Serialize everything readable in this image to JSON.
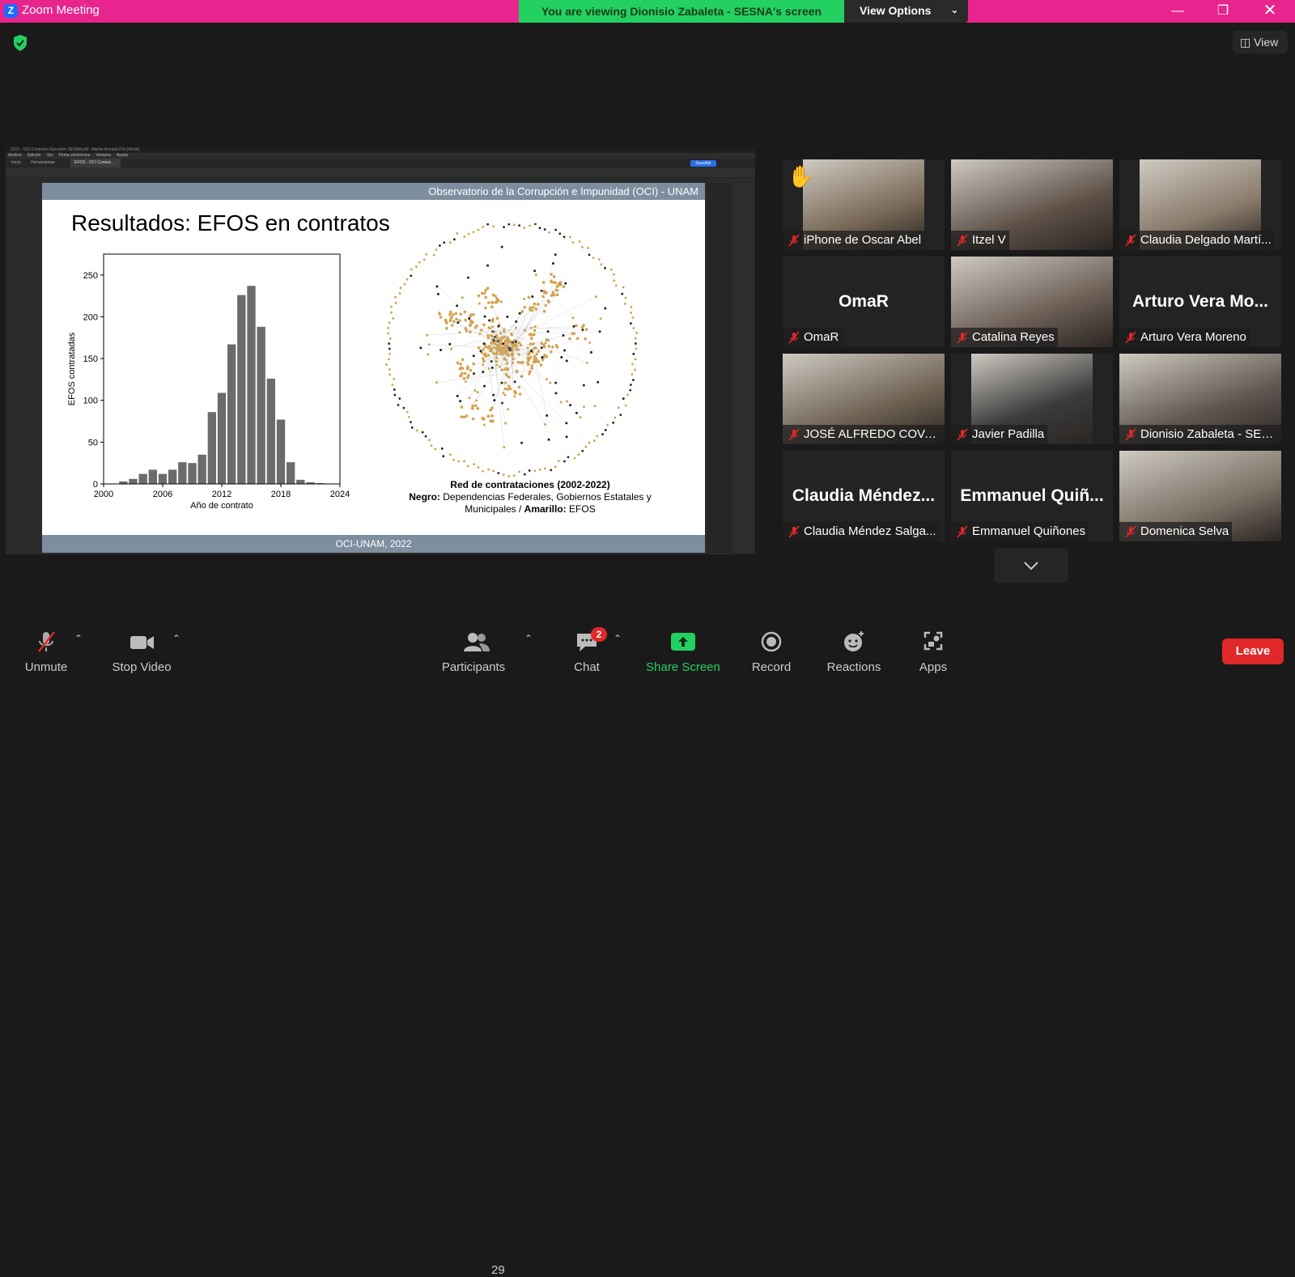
{
  "window": {
    "title": "Zoom Meeting",
    "viewing_banner": "You are viewing Dionisio Zabaleta - SESNA's screen",
    "view_options": "View Options",
    "view_button": "View"
  },
  "shared_screen": {
    "acrobat_title": "2022 - OCI Contratos Ejecutivo SESNA.pdf - Adobe Acrobat Pro (64-bit)",
    "menu": [
      "Archivo",
      "Edición",
      "Ver",
      "Firma electrónica",
      "Ventana",
      "Ayuda"
    ],
    "tabs": [
      "Inicio",
      "Herramientas",
      "EFOS - OCI Contrat..."
    ],
    "subscribe": "Suscribir",
    "slide_header": "Observatorio de la Corrupción e Impunidad (OCI) - UNAM",
    "slide_title": "Resultados: EFOS en contratos",
    "slide_footer": "OCI-UNAM, 2022",
    "network_caption": {
      "title": "Red de contrataciones (2002-2022)",
      "negro_label": "Negro:",
      "negro_text": "Dependencias Federales, Gobiernos Estatales y Municipales /",
      "amarillo_label": "Amarillo:",
      "amarillo_text": "EFOS"
    }
  },
  "chart_data": {
    "type": "bar",
    "title": "",
    "xlabel": "Año de contrato",
    "ylabel": "EFOS contratadas",
    "x": [
      2002,
      2003,
      2004,
      2005,
      2006,
      2007,
      2008,
      2009,
      2010,
      2011,
      2012,
      2013,
      2014,
      2015,
      2016,
      2017,
      2018,
      2019,
      2020,
      2021,
      2022
    ],
    "values": [
      3,
      6,
      12,
      17,
      12,
      17,
      26,
      25,
      35,
      86,
      109,
      167,
      226,
      237,
      188,
      126,
      77,
      26,
      5,
      2,
      1
    ],
    "xlim": [
      2000,
      2024
    ],
    "ylim": [
      0,
      275
    ],
    "xticks": [
      "2000",
      "2006",
      "2012",
      "2018",
      "2024"
    ],
    "yticks": [
      "0",
      "50",
      "100",
      "150",
      "200",
      "250"
    ],
    "bar_color": "#6b6b6b"
  },
  "participants": [
    {
      "name": "iPhone de Oscar Abel",
      "big": "",
      "video": true,
      "hand": "✋",
      "active": false
    },
    {
      "name": "Itzel V",
      "big": "",
      "video": true,
      "active": false
    },
    {
      "name": "Claudia Delgado Martí...",
      "big": "",
      "video": true,
      "active": false
    },
    {
      "name": "OmaR",
      "big": "OmaR",
      "video": false,
      "active": false
    },
    {
      "name": "Catalina Reyes",
      "big": "",
      "video": true,
      "active": false
    },
    {
      "name": "Arturo Vera Moreno",
      "big": "Arturo Vera Mo...",
      "video": false,
      "active": false
    },
    {
      "name": "JOSÉ ALFREDO COVAR...",
      "big": "",
      "video": true,
      "active": false
    },
    {
      "name": "Javier Padilla",
      "big": "",
      "video": true,
      "active": false
    },
    {
      "name": "Dionisio Zabaleta - SESNA",
      "big": "",
      "video": true,
      "active": true
    },
    {
      "name": "Claudia Méndez Salga...",
      "big": "Claudia Méndez...",
      "video": false,
      "active": false
    },
    {
      "name": "Emmanuel Quiñones",
      "big": "Emmanuel Quiñ...",
      "video": false,
      "active": false
    },
    {
      "name": "Domenica Selva",
      "big": "",
      "video": true,
      "active": false
    }
  ],
  "toolbar": {
    "unmute": "Unmute",
    "stop_video": "Stop Video",
    "participants": "Participants",
    "participants_count": "29",
    "chat": "Chat",
    "chat_badge": "2",
    "share_screen": "Share Screen",
    "record": "Record",
    "reactions": "Reactions",
    "apps": "Apps",
    "leave": "Leave"
  },
  "colors": {
    "titlebar": "#e8248e",
    "banner": "#23d160",
    "active_speaker": "#c9e94a",
    "share_green": "#23d160",
    "leave_red": "#e02828",
    "efos_node": "#d4a24c",
    "gov_node": "#222222"
  }
}
